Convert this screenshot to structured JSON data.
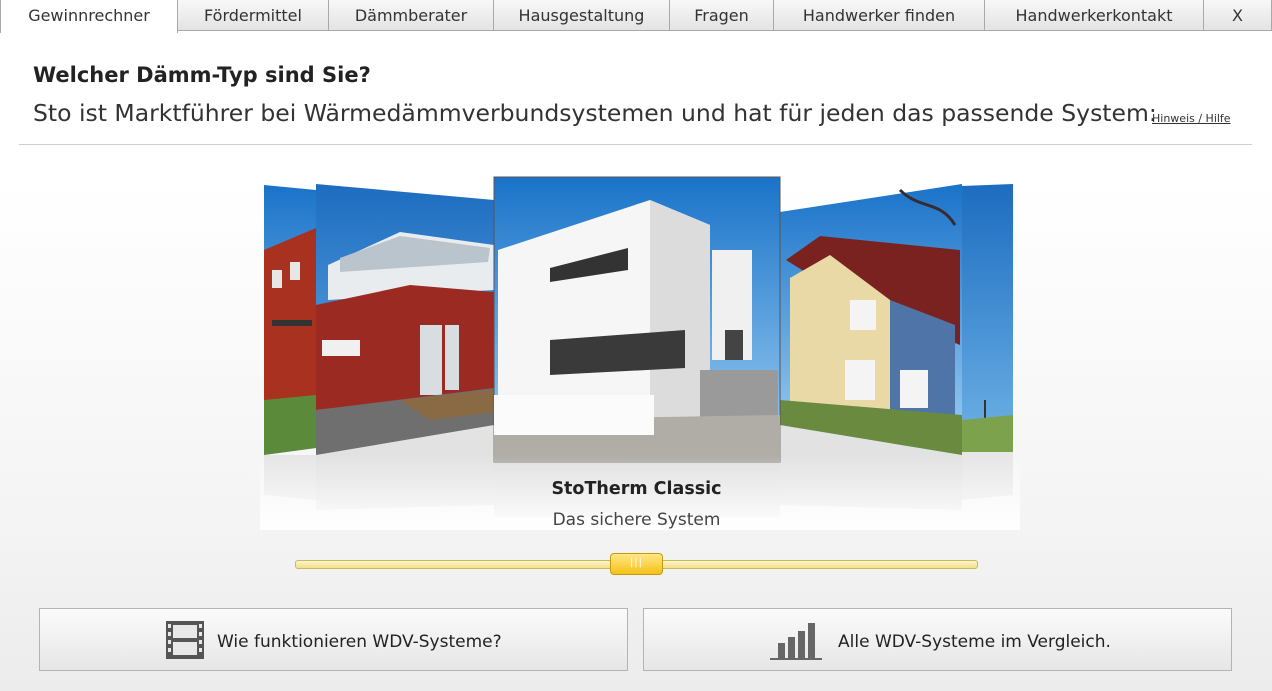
{
  "tabs": [
    {
      "label": "Gewinnrechner",
      "active": true
    },
    {
      "label": "Fördermittel"
    },
    {
      "label": "Dämmberater"
    },
    {
      "label": "Hausgestaltung"
    },
    {
      "label": "Fragen"
    },
    {
      "label": "Handwerker finden"
    },
    {
      "label": "Handwerkerkontakt"
    }
  ],
  "close_label": "X",
  "header": {
    "title": "Welcher Dämm-Typ sind Sie?",
    "subtitle": "Sto ist Marktführer bei Wärmedämmverbundsystemen und hat für jeden das passende System:",
    "help_link": "Hinweis / Hilfe"
  },
  "carousel": {
    "selected_name": "StoTherm Classic",
    "selected_tagline": "Das sichere System",
    "slider_thumb_label": "|||",
    "slider_position": 0.5
  },
  "buttons": {
    "how_it_works": {
      "label": "Wie funktionieren WDV-Systeme?",
      "icon": "film-icon"
    },
    "compare": {
      "label": "Alle WDV-Systeme im Vergleich.",
      "icon": "bar-chart-icon"
    }
  },
  "colors": {
    "slider_accent": "#f5c21a",
    "slider_track": "#f1df8a"
  }
}
